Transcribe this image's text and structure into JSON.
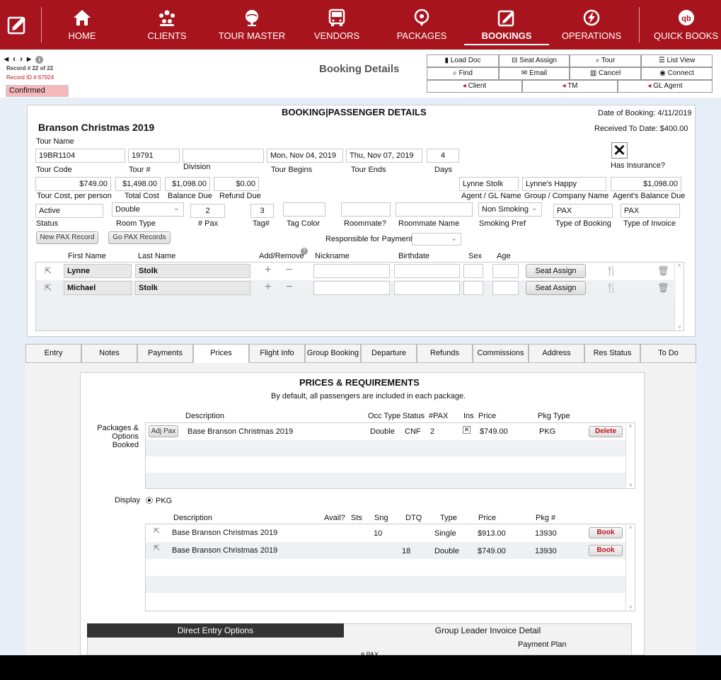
{
  "nav": {
    "items": [
      {
        "label": "HOME",
        "icon": "home-icon"
      },
      {
        "label": "CLIENTS",
        "icon": "clients-icon"
      },
      {
        "label": "TOUR MASTER",
        "icon": "globe-icon"
      },
      {
        "label": "VENDORS",
        "icon": "bus-icon"
      },
      {
        "label": "PACKAGES",
        "icon": "badge-icon"
      },
      {
        "label": "BOOKINGS",
        "icon": "calendar-edit-icon",
        "active": true
      },
      {
        "label": "OPERATIONS",
        "icon": "lightning-icon"
      },
      {
        "label": "QUICK BOOKS",
        "icon": "quickbooks-icon"
      }
    ]
  },
  "header": {
    "record": "Record # 22 of 22",
    "record_id": "Record ID # 67924",
    "status": "Confirmed",
    "title": "Booking Details",
    "toolbar": {
      "load_doc": "Load Doc",
      "seat_assign": "Seat Assign",
      "tour": "Tour",
      "list_view": "List View",
      "find": "Find",
      "email": "Email",
      "cancel": "Cancel",
      "connect": "Connect",
      "client": "Client",
      "tm": "TM",
      "gl_agent": "GL Agent"
    }
  },
  "booking": {
    "section_title": "BOOKING|PASSENGER DETAILS",
    "tour_title": "Branson Christmas 2019",
    "date_of_booking": "Date of Booking: 4/11/2019",
    "received_to_date": "Received To Date: $400.00",
    "tour_name_label": "Tour Name",
    "tour_code": "19BR1104",
    "tour_code_label": "Tour Code",
    "tour_num": "19791",
    "tour_num_label": "Tour #",
    "division": "",
    "division_label": "Division",
    "tour_begins": "Mon, Nov 04, 2019",
    "tour_begins_label": "Tour Begins",
    "tour_ends": "Thu, Nov 07, 2019",
    "tour_ends_label": "Tour Ends",
    "days": "4",
    "days_label": "Days",
    "has_insurance_label": "Has Insurance?",
    "tour_cost": "$749.00",
    "tour_cost_label": "Tour Cost, per person",
    "total_cost": "$1,498.00",
    "total_cost_label": "Total Cost",
    "balance_due": "$1,098.00",
    "balance_due_label": "Balance Due",
    "refund_due": "$0.00",
    "refund_due_label": "Refund Due",
    "agent": "Lynne Stolk",
    "agent_label": "Agent / GL Name",
    "group": "Lynne's Happy",
    "group_label": "Group / Company Name",
    "agent_balance": "$1,098.00",
    "agent_balance_label": "Agent's Balance Due",
    "status": "Active",
    "status_label": "Status",
    "room_type": "Double",
    "room_type_label": "Room Type",
    "pax": "2",
    "pax_label": "# Pax",
    "tag": "3",
    "tag_label": "Tag#",
    "tag_color_label": "Tag Color",
    "roommate_label": "Roommate?",
    "roommate_name_label": "Roommate Name",
    "smoking": "Non Smoking",
    "smoking_label": "Smoking Pref",
    "type_booking": "PAX",
    "type_booking_label": "Type of Booking",
    "type_invoice": "PAX",
    "type_invoice_label": "Type of Invoice",
    "new_pax_btn": "New PAX Record",
    "go_pax_btn": "Go PAX Records",
    "responsible_label": "Responsible for Payment"
  },
  "passengers": {
    "headers": {
      "first": "First Name",
      "last": "Last Name",
      "addremove": "Add/Remove",
      "nickname": "Nickname",
      "birthdate": "Birthdate",
      "sex": "Sex",
      "age": "Age"
    },
    "seat_btn": "Seat Assign",
    "rows": [
      {
        "first": "Lynne",
        "last": "Stolk"
      },
      {
        "first": "Michael",
        "last": "Stolk"
      }
    ]
  },
  "tabs": [
    "Entry",
    "Notes",
    "Payments",
    "Prices",
    "Flight Info",
    "Group Booking",
    "Departure",
    "Refunds",
    "Commissions",
    "Address",
    "Res Status",
    "To Do"
  ],
  "prices": {
    "title": "PRICES & REQUIREMENTS",
    "subtitle": "By default, all passengers are included in each package.",
    "booked_label": "Packages & Options Booked",
    "booked_headers": {
      "description": "Description",
      "occ": "Occ Type",
      "status": "Status",
      "pax": "#PAX",
      "ins": "Ins",
      "price": "Price",
      "pkg": "Pkg Type"
    },
    "booked_rows": [
      {
        "adj": "Adj Pax",
        "description": "Base Branson Christmas 2019",
        "occ": "Double",
        "status": "CNF",
        "pax": "2",
        "price": "$749.00",
        "pkg": "PKG",
        "action": "Delete"
      }
    ],
    "display_label": "Display",
    "display_option": "PKG",
    "avail_headers": {
      "description": "Description",
      "avail": "Avail?",
      "sts": "Sts",
      "sng": "Sng",
      "dtq": "DTQ",
      "type": "Type",
      "price": "Price",
      "pkg": "Pkg #"
    },
    "avail_rows": [
      {
        "description": "Base Branson Christmas 2019",
        "sng": "10",
        "dtq": "",
        "type": "Single",
        "price": "$913.00",
        "pkg": "13930",
        "action": "Book"
      },
      {
        "description": "Base Branson Christmas 2019",
        "sng": "",
        "dtq": "18",
        "type": "Double",
        "price": "$749.00",
        "pkg": "13930",
        "action": "Book"
      }
    ],
    "direct_entry": "Direct Entry Options",
    "gl_invoice": "Group Leader Invoice Detail",
    "payment_plan": "Payment Plan",
    "pax_cut": "# PAX"
  }
}
